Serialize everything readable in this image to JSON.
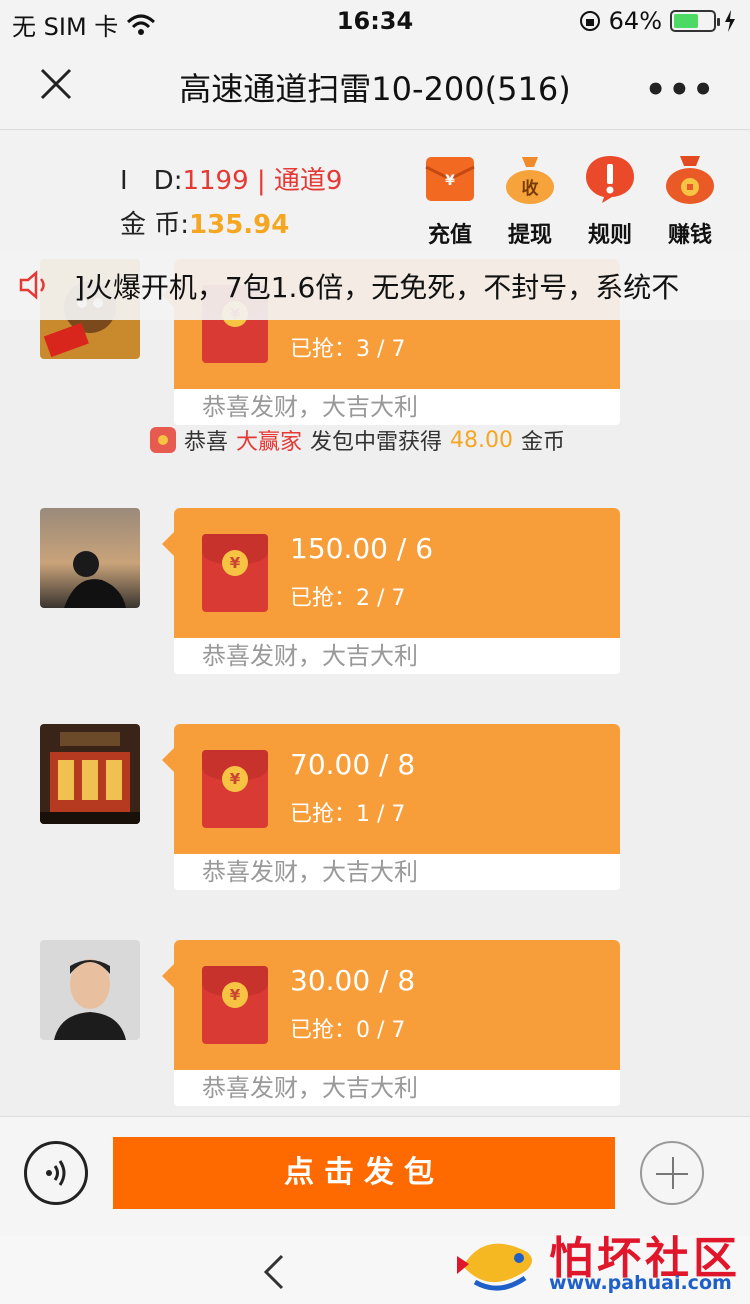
{
  "status_bar": {
    "carrier": "无 SIM 卡",
    "time": "16:34",
    "battery": "64%",
    "battery_level": 0.64
  },
  "nav": {
    "title": "高速通道扫雷10-200(516)"
  },
  "account": {
    "id_label": "I　D:",
    "id_value": "1199 | 通道9",
    "coin_label": "金 币:",
    "coin_value": "135.94"
  },
  "actions": [
    {
      "label": "充值",
      "icon": "recharge-envelope-icon"
    },
    {
      "label": "提现",
      "icon": "withdraw-bag-icon",
      "glyph": "收"
    },
    {
      "label": "规则",
      "icon": "rules-exclamation-icon"
    },
    {
      "label": "赚钱",
      "icon": "earn-money-bag-icon"
    }
  ],
  "notice": {
    "text": "]火爆开机，7包1.6倍，无免死，不封号，系统不"
  },
  "messages": [
    {
      "amount": "",
      "grabbed": "已抢：3 / 7",
      "greeting": "恭喜发财，大吉大利"
    },
    {
      "amount": "150.00 / 6",
      "grabbed": "已抢：2 / 7",
      "greeting": "恭喜发财，大吉大利"
    },
    {
      "amount": "70.00 / 8",
      "grabbed": "已抢：1 / 7",
      "greeting": "恭喜发财，大吉大利"
    },
    {
      "amount": "30.00 / 8",
      "grabbed": "已抢：0 / 7",
      "greeting": "恭喜发财，大吉大利"
    }
  ],
  "system_note": {
    "prefix": "恭喜",
    "winner": "大赢家",
    "middle": "发包中雷获得",
    "amount": "48.00",
    "suffix": "金币"
  },
  "bottom": {
    "send_label": "点击发包"
  },
  "watermark": {
    "brand": "怕坏社区",
    "url": "www.pahuai.com"
  },
  "colors": {
    "accent_orange": "#ff6a00",
    "bubble": "#f79e3b",
    "red": "#e53935",
    "gold": "#f5a623"
  }
}
